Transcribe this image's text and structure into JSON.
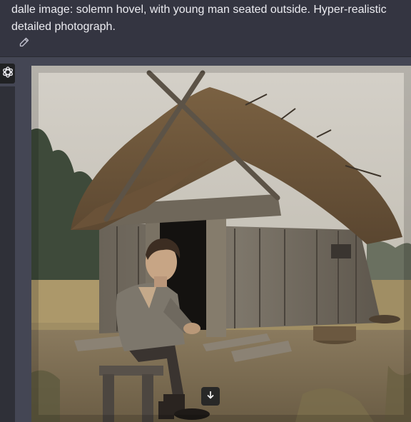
{
  "user_message": {
    "text": "dalle image: solemn hovel, with young man seated outside. Hyper-realistic detailed photograph."
  },
  "icons": {
    "edit": "pencil-icon",
    "assistant": "openai-logo-icon",
    "download": "download-arrow-icon"
  },
  "colors": {
    "background": "#343541",
    "assistant_background": "#444654",
    "text": "#ececf1"
  }
}
